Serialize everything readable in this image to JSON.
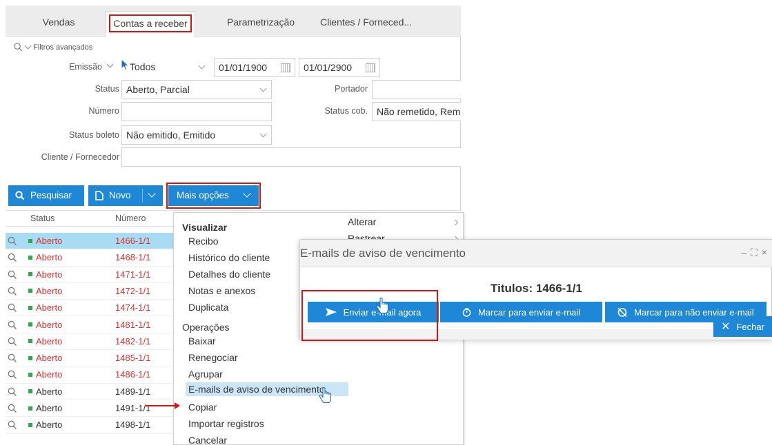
{
  "tabs": [
    {
      "label": "Vendas"
    },
    {
      "label": "Contas a receber"
    },
    {
      "label": "Parametrização"
    },
    {
      "label": "Clientes / Forneced..."
    }
  ],
  "filters": {
    "advanced_label": "Filtros avançados",
    "emissao_label": "Emissão",
    "emissao_value": "Todos",
    "date_from": "01/01/1900",
    "date_to": "01/01/2900",
    "status_label": "Status",
    "status_value": "Aberto, Parcial",
    "portador_label": "Portador",
    "numero_label": "Número",
    "status_cob_label": "Status cob.",
    "status_cob_value": "Não remetido, Rem",
    "status_boleto_label": "Status boleto",
    "status_boleto_value": "Não emitido, Emitido",
    "cliente_label": "Cliente / Fornecedor"
  },
  "toolbar": {
    "search_label": "Pesquisar",
    "new_label": "Novo",
    "more_label": "Mais opções"
  },
  "table": {
    "headers": [
      "Status",
      "Número"
    ],
    "rows": [
      {
        "status": "Aberto",
        "number": "1466-1/1"
      },
      {
        "status": "Aberto",
        "number": "1468-1/1"
      },
      {
        "status": "Aberto",
        "number": "1471-1/1"
      },
      {
        "status": "Aberto",
        "number": "1472-1/1"
      },
      {
        "status": "Aberto",
        "number": "1474-1/1"
      },
      {
        "status": "Aberto",
        "number": "1481-1/1"
      },
      {
        "status": "Aberto",
        "number": "1482-1/1"
      },
      {
        "status": "Aberto",
        "number": "1485-1/1"
      },
      {
        "status": "Aberto",
        "number": "1486-1/1"
      },
      {
        "status": "Aberto",
        "number": "1489-1/1"
      },
      {
        "status": "Aberto",
        "number": "1491-1/1"
      },
      {
        "status": "Aberto",
        "number": "1498-1/1"
      }
    ]
  },
  "menu": {
    "visualizar_header": "Visualizar",
    "recibo": "Recibo",
    "historico": "Histórico do cliente",
    "detalhes": "Detalhes do cliente",
    "notas": "Notas e anexos",
    "duplicata": "Duplicata",
    "operacoes_header": "Operações",
    "baixar": "Baixar",
    "renegociar": "Renegociar",
    "agrupar": "Agrupar",
    "emails": "E-mails de aviso de vencimento",
    "copiar": "Copiar",
    "importar": "Importar registros",
    "cancelar": "Cancelar",
    "alterar": "Alterar",
    "rastrear": "Rastrear"
  },
  "dialog": {
    "title": "E-mails de aviso de vencimento",
    "titulos": "Titulos: 1466-1/1",
    "send_now": "Enviar e-mail agora",
    "mark_send": "Marcar para enviar e-mail",
    "mark_no_send": "Marcar para não enviar e-mail",
    "close": "Fechar"
  },
  "colors": {
    "accent": "#1e88d6",
    "highlight_red": "#e01010",
    "status_green": "#2eaa46",
    "number_red": "#e03030",
    "selected_row": "#a7dcf3"
  }
}
